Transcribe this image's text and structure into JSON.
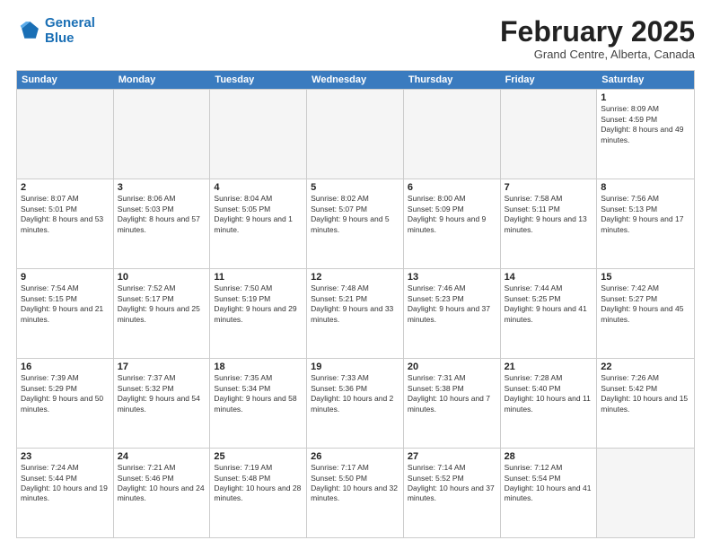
{
  "header": {
    "logo_line1": "General",
    "logo_line2": "Blue",
    "month": "February 2025",
    "location": "Grand Centre, Alberta, Canada"
  },
  "weekdays": [
    "Sunday",
    "Monday",
    "Tuesday",
    "Wednesday",
    "Thursday",
    "Friday",
    "Saturday"
  ],
  "rows": [
    [
      {
        "day": "",
        "info": "",
        "empty": true
      },
      {
        "day": "",
        "info": "",
        "empty": true
      },
      {
        "day": "",
        "info": "",
        "empty": true
      },
      {
        "day": "",
        "info": "",
        "empty": true
      },
      {
        "day": "",
        "info": "",
        "empty": true
      },
      {
        "day": "",
        "info": "",
        "empty": true
      },
      {
        "day": "1",
        "info": "Sunrise: 8:09 AM\nSunset: 4:59 PM\nDaylight: 8 hours and 49 minutes."
      }
    ],
    [
      {
        "day": "2",
        "info": "Sunrise: 8:07 AM\nSunset: 5:01 PM\nDaylight: 8 hours and 53 minutes."
      },
      {
        "day": "3",
        "info": "Sunrise: 8:06 AM\nSunset: 5:03 PM\nDaylight: 8 hours and 57 minutes."
      },
      {
        "day": "4",
        "info": "Sunrise: 8:04 AM\nSunset: 5:05 PM\nDaylight: 9 hours and 1 minute."
      },
      {
        "day": "5",
        "info": "Sunrise: 8:02 AM\nSunset: 5:07 PM\nDaylight: 9 hours and 5 minutes."
      },
      {
        "day": "6",
        "info": "Sunrise: 8:00 AM\nSunset: 5:09 PM\nDaylight: 9 hours and 9 minutes."
      },
      {
        "day": "7",
        "info": "Sunrise: 7:58 AM\nSunset: 5:11 PM\nDaylight: 9 hours and 13 minutes."
      },
      {
        "day": "8",
        "info": "Sunrise: 7:56 AM\nSunset: 5:13 PM\nDaylight: 9 hours and 17 minutes."
      }
    ],
    [
      {
        "day": "9",
        "info": "Sunrise: 7:54 AM\nSunset: 5:15 PM\nDaylight: 9 hours and 21 minutes."
      },
      {
        "day": "10",
        "info": "Sunrise: 7:52 AM\nSunset: 5:17 PM\nDaylight: 9 hours and 25 minutes."
      },
      {
        "day": "11",
        "info": "Sunrise: 7:50 AM\nSunset: 5:19 PM\nDaylight: 9 hours and 29 minutes."
      },
      {
        "day": "12",
        "info": "Sunrise: 7:48 AM\nSunset: 5:21 PM\nDaylight: 9 hours and 33 minutes."
      },
      {
        "day": "13",
        "info": "Sunrise: 7:46 AM\nSunset: 5:23 PM\nDaylight: 9 hours and 37 minutes."
      },
      {
        "day": "14",
        "info": "Sunrise: 7:44 AM\nSunset: 5:25 PM\nDaylight: 9 hours and 41 minutes."
      },
      {
        "day": "15",
        "info": "Sunrise: 7:42 AM\nSunset: 5:27 PM\nDaylight: 9 hours and 45 minutes."
      }
    ],
    [
      {
        "day": "16",
        "info": "Sunrise: 7:39 AM\nSunset: 5:29 PM\nDaylight: 9 hours and 50 minutes."
      },
      {
        "day": "17",
        "info": "Sunrise: 7:37 AM\nSunset: 5:32 PM\nDaylight: 9 hours and 54 minutes."
      },
      {
        "day": "18",
        "info": "Sunrise: 7:35 AM\nSunset: 5:34 PM\nDaylight: 9 hours and 58 minutes."
      },
      {
        "day": "19",
        "info": "Sunrise: 7:33 AM\nSunset: 5:36 PM\nDaylight: 10 hours and 2 minutes."
      },
      {
        "day": "20",
        "info": "Sunrise: 7:31 AM\nSunset: 5:38 PM\nDaylight: 10 hours and 7 minutes."
      },
      {
        "day": "21",
        "info": "Sunrise: 7:28 AM\nSunset: 5:40 PM\nDaylight: 10 hours and 11 minutes."
      },
      {
        "day": "22",
        "info": "Sunrise: 7:26 AM\nSunset: 5:42 PM\nDaylight: 10 hours and 15 minutes."
      }
    ],
    [
      {
        "day": "23",
        "info": "Sunrise: 7:24 AM\nSunset: 5:44 PM\nDaylight: 10 hours and 19 minutes."
      },
      {
        "day": "24",
        "info": "Sunrise: 7:21 AM\nSunset: 5:46 PM\nDaylight: 10 hours and 24 minutes."
      },
      {
        "day": "25",
        "info": "Sunrise: 7:19 AM\nSunset: 5:48 PM\nDaylight: 10 hours and 28 minutes."
      },
      {
        "day": "26",
        "info": "Sunrise: 7:17 AM\nSunset: 5:50 PM\nDaylight: 10 hours and 32 minutes."
      },
      {
        "day": "27",
        "info": "Sunrise: 7:14 AM\nSunset: 5:52 PM\nDaylight: 10 hours and 37 minutes."
      },
      {
        "day": "28",
        "info": "Sunrise: 7:12 AM\nSunset: 5:54 PM\nDaylight: 10 hours and 41 minutes."
      },
      {
        "day": "",
        "info": "",
        "empty": true
      }
    ]
  ]
}
